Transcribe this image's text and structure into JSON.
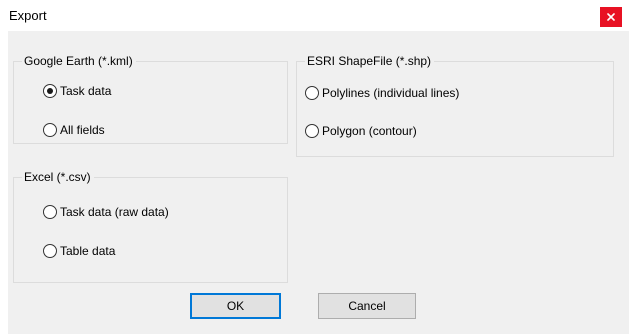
{
  "window": {
    "title": "Export",
    "close_glyph": "x",
    "close_color": "#e81123"
  },
  "groups": {
    "kml": {
      "label": "Google Earth (*.kml)",
      "options": [
        {
          "label": "Task data",
          "checked": true
        },
        {
          "label": "All fields",
          "checked": false
        }
      ]
    },
    "shp": {
      "label": "ESRI ShapeFile (*.shp)",
      "options": [
        {
          "label": "Polylines (individual lines)",
          "checked": false
        },
        {
          "label": "Polygon (contour)",
          "checked": false
        }
      ]
    },
    "csv": {
      "label": "Excel (*.csv)",
      "options": [
        {
          "label": "Task data (raw data)",
          "checked": false
        },
        {
          "label": "Table data",
          "checked": false
        }
      ]
    }
  },
  "buttons": {
    "ok": "OK",
    "cancel": "Cancel"
  },
  "colors": {
    "dialog_bg": "#f0f0f0",
    "accent": "#0078d7"
  }
}
